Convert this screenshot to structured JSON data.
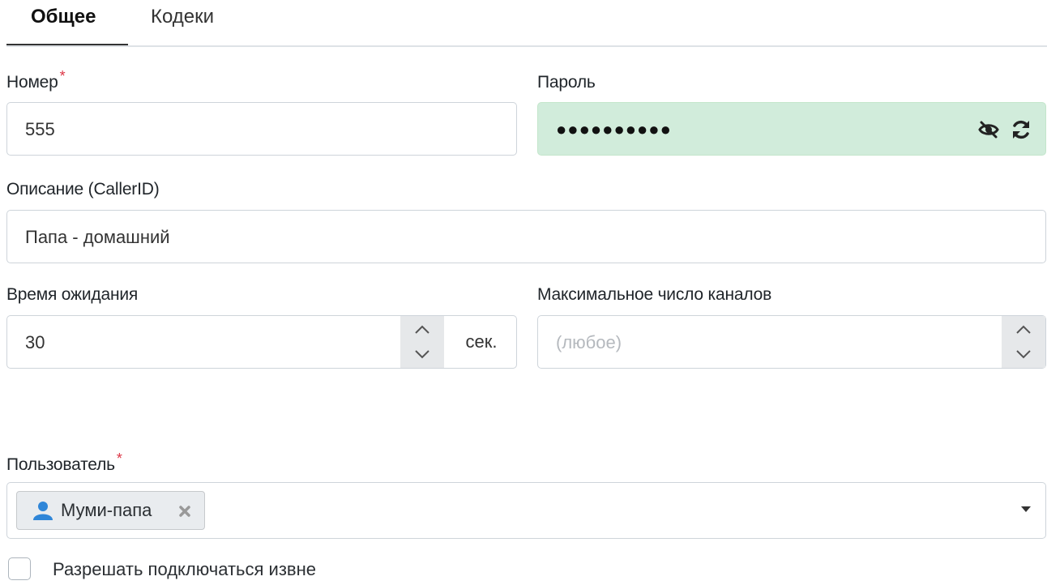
{
  "tabs": [
    {
      "label": "Общее",
      "active": true
    },
    {
      "label": "Кодеки",
      "active": false
    }
  ],
  "number": {
    "label": "Номер",
    "required_mark": "*",
    "value": "555"
  },
  "password": {
    "label": "Пароль",
    "masked_value": "●●●●●●●●●●",
    "icons": [
      "eye-slash-icon",
      "refresh-icon"
    ],
    "background": "#d1ecdb"
  },
  "description": {
    "label": "Описание (CallerID)",
    "value": "Папа - домашний"
  },
  "timeout": {
    "label": "Время ожидания",
    "value": "30",
    "unit": "сек."
  },
  "max_channels": {
    "label": "Максимальное число каналов",
    "placeholder": "(любое)"
  },
  "user": {
    "label": "Пользователь",
    "required_mark": "*",
    "selected": "Муми-папа",
    "icon": "user-icon"
  },
  "allow_external": {
    "label": "Разрешать подключаться извне",
    "checked": false
  },
  "colors": {
    "required": "#dc3545",
    "password_ok": "#d1ecdb",
    "user_icon": "#2f86d8"
  }
}
